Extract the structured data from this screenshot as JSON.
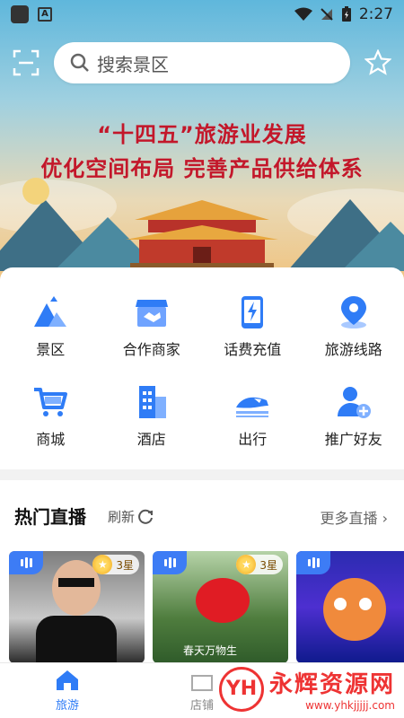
{
  "status_bar": {
    "time": "2:27"
  },
  "search": {
    "placeholder": "搜索景区"
  },
  "banner": {
    "line1": "“十四五”旅游业发展",
    "line2": "优化空间布局 完善产品供给体系"
  },
  "categories": [
    {
      "label": "景区",
      "icon": "mountain-icon",
      "color": "#2f7cf6"
    },
    {
      "label": "合作商家",
      "icon": "handshake-store-icon",
      "color": "#2f7cf6"
    },
    {
      "label": "话费充值",
      "icon": "phone-charge-icon",
      "color": "#2f7cf6"
    },
    {
      "label": "旅游线路",
      "icon": "location-pin-icon",
      "color": "#2f7cf6"
    },
    {
      "label": "商城",
      "icon": "shopping-cart-icon",
      "color": "#2f7cf6"
    },
    {
      "label": "酒店",
      "icon": "hotel-building-icon",
      "color": "#2f7cf6"
    },
    {
      "label": "出行",
      "icon": "train-icon",
      "color": "#2f7cf6"
    },
    {
      "label": "推广好友",
      "icon": "add-friend-icon",
      "color": "#2f7cf6"
    }
  ],
  "live": {
    "title": "热门直播",
    "refresh": "刷新",
    "more": "更多直播",
    "cards": [
      {
        "stars": "3星"
      },
      {
        "stars": "3星",
        "caption": "春天万物生"
      },
      {
        "stars": ""
      }
    ]
  },
  "nav": {
    "home": "旅游",
    "second": "店铺"
  },
  "watermark": {
    "logo": "YH",
    "name": "永辉资源网",
    "url": "www.yhkjjjjj.com"
  },
  "colors": {
    "accent": "#2f7cf6",
    "banner_text": "#c3172a"
  }
}
